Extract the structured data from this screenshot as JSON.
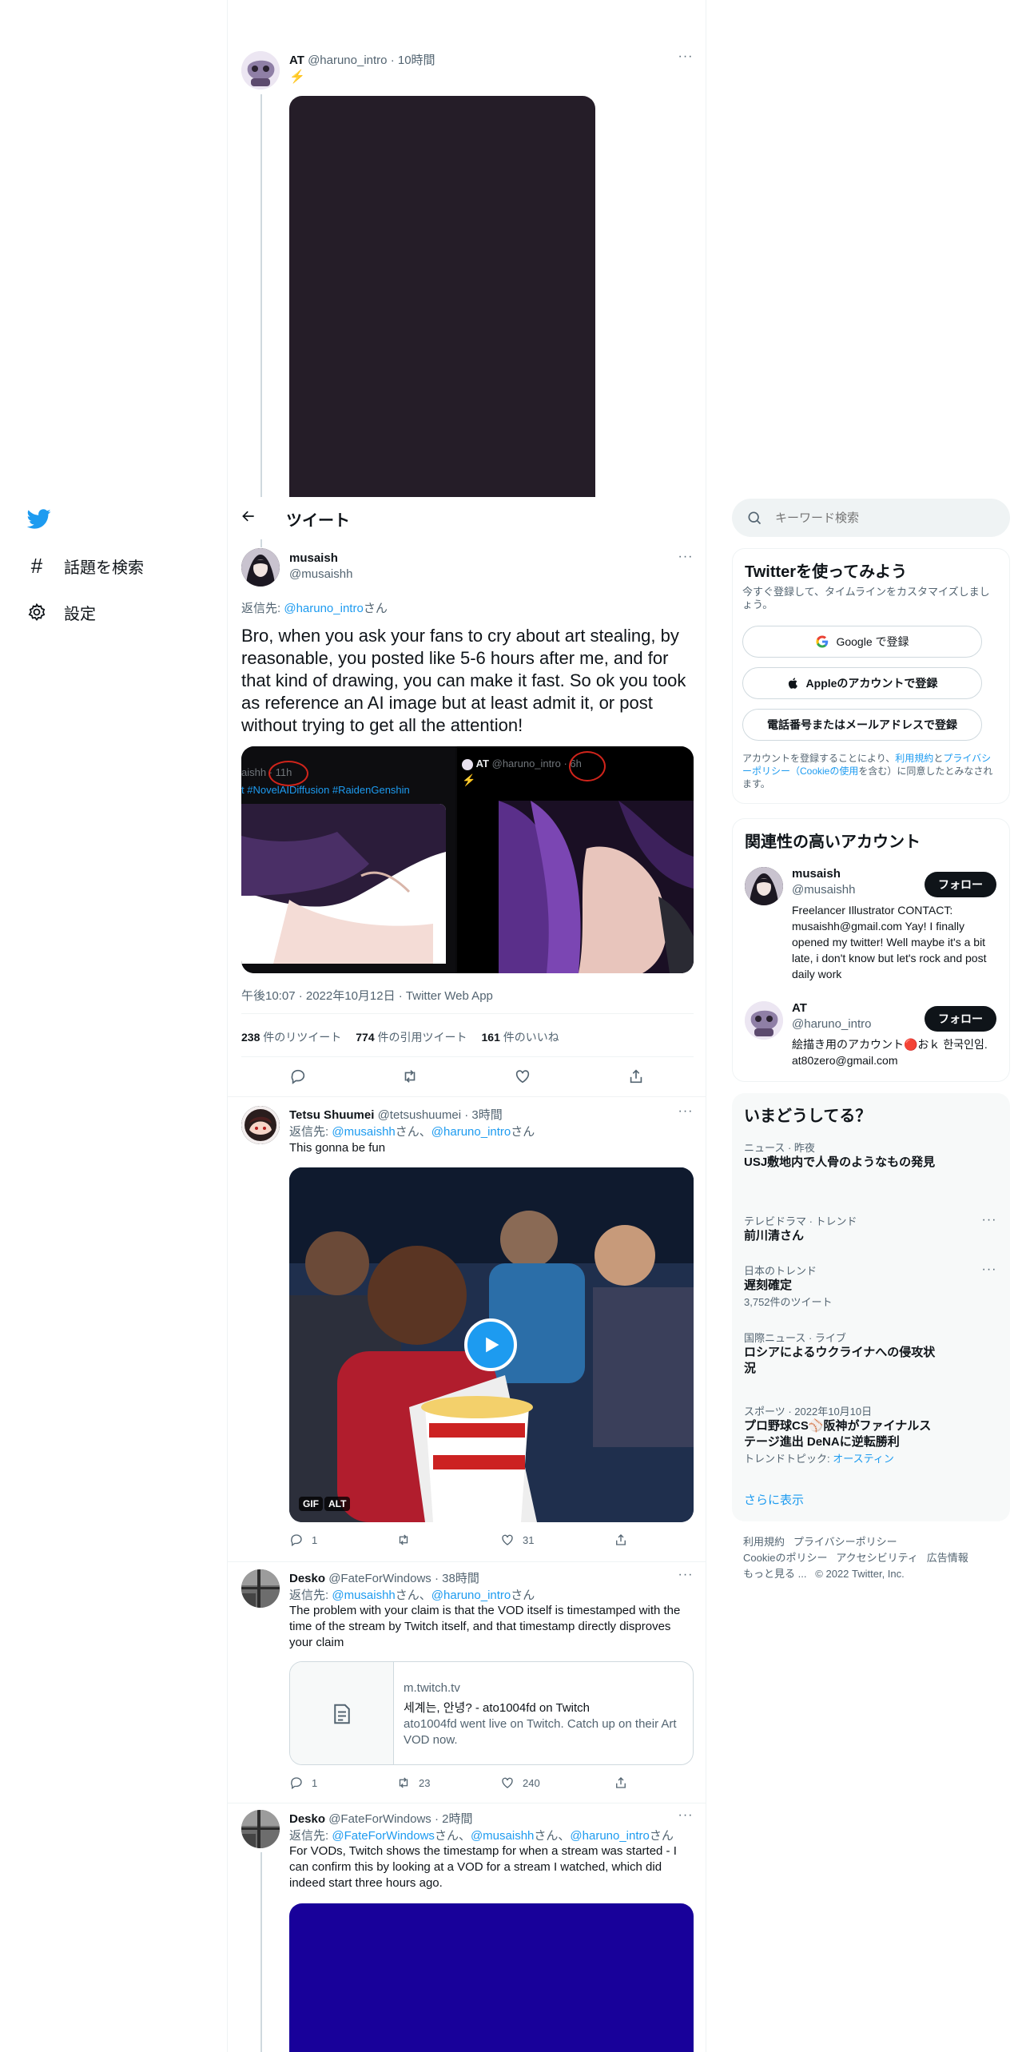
{
  "nav": {
    "search_label": "話題を検索",
    "settings_label": "設定"
  },
  "header": {
    "title": "ツイート"
  },
  "parent": {
    "name": "AT",
    "handle": "@haruno_intro",
    "time": "10時間",
    "text": "⚡"
  },
  "main_tweet": {
    "name": "musaish",
    "handle": "@musaishh",
    "reply_prefix": "返信先:",
    "reply_to": "@haruno_intro",
    "reply_suffix": "さん",
    "text": "Bro, when you ask your fans to cry about art stealing, by reasonable, you posted like 5-6 hours after me, and for that kind of drawing, you can make it fast. So ok you took as reference an AI image but at least admit it, or post without trying to get all the attention!",
    "img_left_top": "aishh · 11h",
    "img_left_tags": "t #NovelAIDiffusion #RaidenGenshin",
    "img_right_name": "AT",
    "img_right_handle": "@haruno_intro",
    "img_right_time": "6h",
    "img_right_text": "⚡",
    "meta": "午後10:07 · 2022年10月12日 · Twitter Web App",
    "retweets_num": "238",
    "retweets_label": "件のリツイート",
    "quotes_num": "774",
    "quotes_label": "件の引用ツイート",
    "likes_num": "161",
    "likes_label": "件のいいね"
  },
  "replies": [
    {
      "name": "Tetsu Shuumei",
      "handle": "@tetsushuumei",
      "time": "3時間",
      "reply_prefix": "返信先:",
      "reply_to_1": "@musaishh",
      "mid": "さん、",
      "reply_to_2": "@haruno_intro",
      "reply_suffix": "さん",
      "text": "This gonna be fun",
      "badge_gif": "GIF",
      "badge_alt": "ALT",
      "replies": "1",
      "retweets": "",
      "likes": "31"
    },
    {
      "name": "Desko",
      "handle": "@FateForWindows",
      "time": "38時間",
      "reply_prefix": "返信先:",
      "reply_to_1": "@musaishh",
      "mid": "さん、",
      "reply_to_2": "@haruno_intro",
      "reply_suffix": "さん",
      "text": "The problem with your claim is that the VOD itself is timestamped with the time of the stream by Twitch itself, and that timestamp directly disproves your claim",
      "card_domain": "m.twitch.tv",
      "card_title": "세계는, 안녕? - ato1004fd on Twitch",
      "card_desc": "ato1004fd went live on Twitch. Catch up on their Art VOD now.",
      "replies": "1",
      "retweets": "23",
      "likes": "240"
    },
    {
      "name": "Desko",
      "handle": "@FateForWindows",
      "time": "2時間",
      "reply_prefix": "返信先:",
      "reply_to_1": "@FateForWindows",
      "mid1": "さん、",
      "reply_to_2": "@musaishh",
      "mid2": "さん、",
      "reply_to_3": "@haruno_intro",
      "reply_suffix": "さん",
      "text": "For VODs, Twitch shows the timestamp for when a stream was started - I can confirm this by looking at a VOD for a stream I watched, which did indeed start three hours ago."
    }
  ],
  "search": {
    "placeholder": "キーワード検索"
  },
  "signup": {
    "title": "Twitterを使ってみよう",
    "subtitle": "今すぐ登録して、タイムラインをカスタマイズしましょう。",
    "google": "Google で登録",
    "apple": "Appleのアカウントで登録",
    "phone": "電話番号またはメールアドレスで登録",
    "terms_pre": "アカウントを登録することにより、",
    "terms_link1": "利用規約",
    "terms_mid": "と",
    "terms_link2": "プライバシーポリシー（Cookieの使用",
    "terms_post": "を含む）に同意したとみなされます。"
  },
  "related": {
    "title": "関連性の高いアカウント",
    "accounts": [
      {
        "name": "musaish",
        "handle": "@musaishh",
        "bio": "Freelancer Illustrator CONTACT: musaishh@gmail.com Yay! I finally opened my twitter! Well maybe it's a bit late, i don't know but let's rock and post daily work",
        "follow": "フォロー"
      },
      {
        "name": "AT",
        "handle": "@haruno_intro",
        "bio": "絵描き用のアカウント🔴おｋ 한국인임. at80zero@gmail.com",
        "follow": "フォロー"
      }
    ]
  },
  "trends": {
    "title": "いまどうしてる？",
    "items": [
      {
        "meta": "ニュース · 昨夜",
        "title": "USJ敷地内で人骨のようなもの発見"
      },
      {
        "meta": "テレビドラマ · トレンド",
        "title": "前川清さん"
      },
      {
        "meta": "日本のトレンド",
        "title": "遅刻確定",
        "count": "3,752件のツイート"
      },
      {
        "meta": "国際ニュース · ライブ",
        "title": "ロシアによるウクライナへの侵攻状況"
      },
      {
        "meta": "スポーツ · 2022年10月10日",
        "title": "プロ野球CS⚾阪神がファイナルステージ進出 DeNAに逆転勝利",
        "topic_label": "トレンドトピック:",
        "topic": "オースティン"
      }
    ],
    "show_more": "さらに表示"
  },
  "footer": {
    "terms": "利用規約",
    "privacy": "プライバシーポリシー",
    "cookie": "Cookieのポリシー",
    "access": "アクセシビリティ",
    "ads": "広告情報",
    "more": "もっと見る ...",
    "copyright": "© 2022 Twitter, Inc."
  },
  "colors": {
    "accent": "#1d9bf0",
    "text": "#0f1419",
    "secondary": "#536471"
  }
}
